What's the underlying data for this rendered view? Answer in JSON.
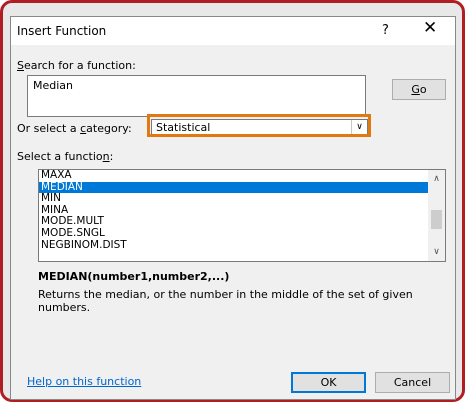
{
  "dialog": {
    "title": "Insert Function",
    "help_glyph": "?",
    "close_glyph": "✕"
  },
  "search": {
    "label_prefix": "",
    "label_accel": "S",
    "label_rest": "earch for a function:",
    "value": "Median",
    "go_accel": "G",
    "go_rest": "o"
  },
  "category": {
    "label_prefix": "Or select a ",
    "label_accel": "c",
    "label_rest": "ategory:",
    "selected": "Statistical",
    "highlight_color": "#e07a10"
  },
  "function_list": {
    "label_prefix": "Select a functio",
    "label_accel": "n",
    "label_rest": ":",
    "items": [
      "MAXA",
      "MEDIAN",
      "MIN",
      "MINA",
      "MODE.MULT",
      "MODE.SNGL",
      "NEGBINOM.DIST"
    ],
    "selected_index": 1,
    "selection_color": "#0078d7"
  },
  "details": {
    "syntax": "MEDIAN(number1,number2,...)",
    "description": "Returns the median, or the number in the middle of the set of given numbers."
  },
  "footer": {
    "help_link": "Help on this function",
    "ok_label": "OK",
    "cancel_label": "Cancel"
  },
  "colors": {
    "frame_border": "#b01e23",
    "link": "#0066cc"
  }
}
